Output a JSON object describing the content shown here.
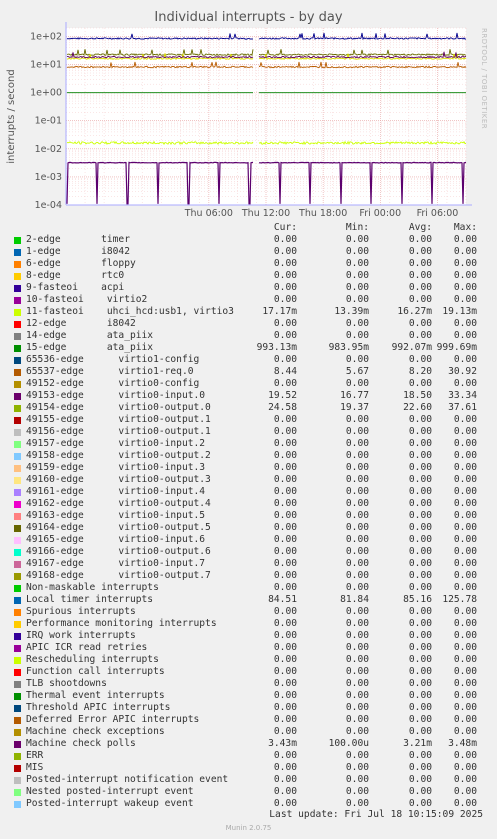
{
  "chart_data": {
    "type": "line",
    "title": "Individual interrupts - by day",
    "ylabel": "interrupts / second",
    "yscale": "log",
    "ylim": [
      0.0001,
      200
    ],
    "y_ticks": [
      "1e+02",
      "1e+01",
      "1e+00",
      "1e-01",
      "1e-02",
      "1e-03",
      "1e-04"
    ],
    "y_tick_values": [
      100,
      10,
      1,
      0.1,
      0.01,
      0.001,
      0.0001
    ],
    "x_ticks": [
      "Thu 06:00",
      "Thu 12:00",
      "Thu 18:00",
      "Fri 00:00",
      "Fri 06:00"
    ],
    "xlim_hours": [
      -9,
      33
    ],
    "x_tick_hours": [
      6,
      12,
      18,
      24,
      30
    ],
    "grid": true,
    "series_plotted": [
      {
        "name": "Local timer interrupts",
        "color": "#00008c",
        "level": 85.16
      },
      {
        "name": "49154-edge virtio0-output.0",
        "color": "#6b6b00",
        "level": 22.6
      },
      {
        "name": "11-fasteoi uhci_hcd:usb1, virtio3",
        "color": "#dede00",
        "level": 16.27
      },
      {
        "name": "49153-edge virtio0-input.0",
        "color": "#5c005c",
        "level": 18.5
      },
      {
        "name": "65537-edge virtio1-req.0",
        "color": "#b85c00",
        "level": 8.2
      },
      {
        "name": "15-edge ata_piix",
        "color": "#008000",
        "level": 0.992
      },
      {
        "name": "11-fasteoi uhci_hcd:usb1, virtio3",
        "color": "#ccff00",
        "level": 0.01627
      },
      {
        "name": "Machine check polls",
        "color": "#5c006e",
        "level": 0.00321
      }
    ]
  },
  "side_note": "RRDTOOL / TOBI OETIKER",
  "legend_header": {
    "cur": "Cur:",
    "min": "Min:",
    "avg": "Avg:",
    "max": "Max:"
  },
  "legend": [
    {
      "label": "2-edge       timer",
      "color": "#00cc00",
      "cur": "0.00",
      "min": "0.00",
      "avg": "0.00",
      "max": "0.00"
    },
    {
      "label": "1-edge       i8042",
      "color": "#0066b3",
      "cur": "0.00",
      "min": "0.00",
      "avg": "0.00",
      "max": "0.00"
    },
    {
      "label": "6-edge       floppy",
      "color": "#ff8000",
      "cur": "0.00",
      "min": "0.00",
      "avg": "0.00",
      "max": "0.00"
    },
    {
      "label": "8-edge       rtc0",
      "color": "#ffcc00",
      "cur": "0.00",
      "min": "0.00",
      "avg": "0.00",
      "max": "0.00"
    },
    {
      "label": "9-fasteoi    acpi",
      "color": "#330099",
      "cur": "0.00",
      "min": "0.00",
      "avg": "0.00",
      "max": "0.00"
    },
    {
      "label": "10-fasteoi    virtio2",
      "color": "#990099",
      "cur": "0.00",
      "min": "0.00",
      "avg": "0.00",
      "max": "0.00"
    },
    {
      "label": "11-fasteoi    uhci_hcd:usb1, virtio3",
      "color": "#ccff00",
      "cur": "17.17m",
      "min": "13.39m",
      "avg": "16.27m",
      "max": "19.13m"
    },
    {
      "label": "12-edge       i8042",
      "color": "#ff0000",
      "cur": "0.00",
      "min": "0.00",
      "avg": "0.00",
      "max": "0.00"
    },
    {
      "label": "14-edge       ata_piix",
      "color": "#808080",
      "cur": "0.00",
      "min": "0.00",
      "avg": "0.00",
      "max": "0.00"
    },
    {
      "label": "15-edge       ata_piix",
      "color": "#008f00",
      "cur": "993.13m",
      "min": "983.95m",
      "avg": "992.07m",
      "max": "999.69m"
    },
    {
      "label": "65536-edge      virtio1-config",
      "color": "#00487d",
      "cur": "0.00",
      "min": "0.00",
      "avg": "0.00",
      "max": "0.00"
    },
    {
      "label": "65537-edge      virtio1-req.0",
      "color": "#b35a00",
      "cur": "8.44",
      "min": "5.67",
      "avg": "8.20",
      "max": "30.92"
    },
    {
      "label": "49152-edge      virtio0-config",
      "color": "#b38f00",
      "cur": "0.00",
      "min": "0.00",
      "avg": "0.00",
      "max": "0.00"
    },
    {
      "label": "49153-edge      virtio0-input.0",
      "color": "#6b006b",
      "cur": "19.52",
      "min": "16.77",
      "avg": "18.50",
      "max": "33.34"
    },
    {
      "label": "49154-edge      virtio0-output.0",
      "color": "#8fb300",
      "cur": "24.58",
      "min": "19.37",
      "avg": "22.60",
      "max": "37.61"
    },
    {
      "label": "49155-edge      virtio0-output.1",
      "color": "#b30000",
      "cur": "0.00",
      "min": "0.00",
      "avg": "0.00",
      "max": "0.00"
    },
    {
      "label": "49156-edge      virtio0-output.1",
      "color": "#bebebe",
      "cur": "0.00",
      "min": "0.00",
      "avg": "0.00",
      "max": "0.00"
    },
    {
      "label": "49157-edge      virtio0-input.2",
      "color": "#80ff80",
      "cur": "0.00",
      "min": "0.00",
      "avg": "0.00",
      "max": "0.00"
    },
    {
      "label": "49158-edge      virtio0-output.2",
      "color": "#80c9ff",
      "cur": "0.00",
      "min": "0.00",
      "avg": "0.00",
      "max": "0.00"
    },
    {
      "label": "49159-edge      virtio0-input.3",
      "color": "#ffc080",
      "cur": "0.00",
      "min": "0.00",
      "avg": "0.00",
      "max": "0.00"
    },
    {
      "label": "49160-edge      virtio0-output.3",
      "color": "#ffe680",
      "cur": "0.00",
      "min": "0.00",
      "avg": "0.00",
      "max": "0.00"
    },
    {
      "label": "49161-edge      virtio0-input.4",
      "color": "#aa80ff",
      "cur": "0.00",
      "min": "0.00",
      "avg": "0.00",
      "max": "0.00"
    },
    {
      "label": "49162-edge      virtio0-output.4",
      "color": "#ee00cc",
      "cur": "0.00",
      "min": "0.00",
      "avg": "0.00",
      "max": "0.00"
    },
    {
      "label": "49163-edge      virtio0-input.5",
      "color": "#ff8080",
      "cur": "0.00",
      "min": "0.00",
      "avg": "0.00",
      "max": "0.00"
    },
    {
      "label": "49164-edge      virtio0-output.5",
      "color": "#666600",
      "cur": "0.00",
      "min": "0.00",
      "avg": "0.00",
      "max": "0.00"
    },
    {
      "label": "49165-edge      virtio0-input.6",
      "color": "#ffbfff",
      "cur": "0.00",
      "min": "0.00",
      "avg": "0.00",
      "max": "0.00"
    },
    {
      "label": "49166-edge      virtio0-output.6",
      "color": "#00ffcc",
      "cur": "0.00",
      "min": "0.00",
      "avg": "0.00",
      "max": "0.00"
    },
    {
      "label": "49167-edge      virtio0-input.7",
      "color": "#cc6699",
      "cur": "0.00",
      "min": "0.00",
      "avg": "0.00",
      "max": "0.00"
    },
    {
      "label": "49168-edge      virtio0-output.7",
      "color": "#999900",
      "cur": "0.00",
      "min": "0.00",
      "avg": "0.00",
      "max": "0.00"
    },
    {
      "label": "Non-maskable interrupts",
      "color": "#00cc00",
      "cur": "0.00",
      "min": "0.00",
      "avg": "0.00",
      "max": "0.00"
    },
    {
      "label": "Local timer interrupts",
      "color": "#0066b3",
      "cur": "84.51",
      "min": "81.84",
      "avg": "85.16",
      "max": "125.78"
    },
    {
      "label": "Spurious interrupts",
      "color": "#ff8000",
      "cur": "0.00",
      "min": "0.00",
      "avg": "0.00",
      "max": "0.00"
    },
    {
      "label": "Performance monitoring interrupts",
      "color": "#ffcc00",
      "cur": "0.00",
      "min": "0.00",
      "avg": "0.00",
      "max": "0.00"
    },
    {
      "label": "IRQ work interrupts",
      "color": "#330099",
      "cur": "0.00",
      "min": "0.00",
      "avg": "0.00",
      "max": "0.00"
    },
    {
      "label": "APIC ICR read retries",
      "color": "#990099",
      "cur": "0.00",
      "min": "0.00",
      "avg": "0.00",
      "max": "0.00"
    },
    {
      "label": "Rescheduling interrupts",
      "color": "#ccff00",
      "cur": "0.00",
      "min": "0.00",
      "avg": "0.00",
      "max": "0.00"
    },
    {
      "label": "Function call interrupts",
      "color": "#ff0000",
      "cur": "0.00",
      "min": "0.00",
      "avg": "0.00",
      "max": "0.00"
    },
    {
      "label": "TLB shootdowns",
      "color": "#808080",
      "cur": "0.00",
      "min": "0.00",
      "avg": "0.00",
      "max": "0.00"
    },
    {
      "label": "Thermal event interrupts",
      "color": "#008f00",
      "cur": "0.00",
      "min": "0.00",
      "avg": "0.00",
      "max": "0.00"
    },
    {
      "label": "Threshold APIC interrupts",
      "color": "#00487d",
      "cur": "0.00",
      "min": "0.00",
      "avg": "0.00",
      "max": "0.00"
    },
    {
      "label": "Deferred Error APIC interrupts",
      "color": "#b35a00",
      "cur": "0.00",
      "min": "0.00",
      "avg": "0.00",
      "max": "0.00"
    },
    {
      "label": "Machine check exceptions",
      "color": "#b38f00",
      "cur": "0.00",
      "min": "0.00",
      "avg": "0.00",
      "max": "0.00"
    },
    {
      "label": "Machine check polls",
      "color": "#6b006b",
      "cur": "3.43m",
      "min": "100.00u",
      "avg": "3.21m",
      "max": "3.48m"
    },
    {
      "label": "ERR",
      "color": "#8fb300",
      "cur": "0.00",
      "min": "0.00",
      "avg": "0.00",
      "max": "0.00"
    },
    {
      "label": "MIS",
      "color": "#b30000",
      "cur": "0.00",
      "min": "0.00",
      "avg": "0.00",
      "max": "0.00"
    },
    {
      "label": "Posted-interrupt notification event",
      "color": "#bebebe",
      "cur": "0.00",
      "min": "0.00",
      "avg": "0.00",
      "max": "0.00"
    },
    {
      "label": "Nested posted-interrupt event",
      "color": "#80ff80",
      "cur": "0.00",
      "min": "0.00",
      "avg": "0.00",
      "max": "0.00"
    },
    {
      "label": "Posted-interrupt wakeup event",
      "color": "#80c9ff",
      "cur": "0.00",
      "min": "0.00",
      "avg": "0.00",
      "max": "0.00"
    }
  ],
  "last_update": "Last update: Fri Jul 18 10:15:09 2025",
  "footer": "Munin 2.0.75"
}
